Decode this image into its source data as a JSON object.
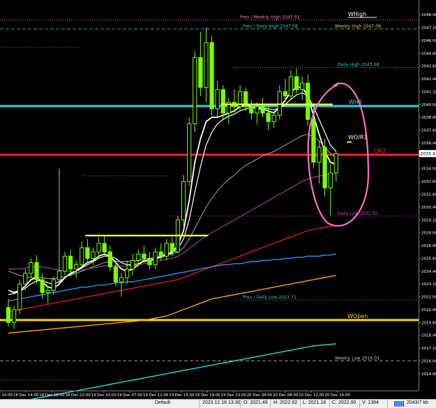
{
  "chart_data": {
    "type": "candlestick",
    "symbol_corner_label": "",
    "y_ticks": [
      "2048.40",
      "2047.20",
      "2046.00",
      "2044.80",
      "2043.60",
      "2042.40",
      "2041.20",
      "2040.00",
      "2038.80",
      "2037.60",
      "2036.40",
      "2035.20",
      "2034.00",
      "2032.80",
      "2031.60",
      "2030.40",
      "2029.20",
      "2028.00",
      "2026.80",
      "2025.60",
      "2024.40",
      "2023.20",
      "2022.00",
      "2020.80",
      "2019.60",
      "2018.40",
      "2017.20",
      "2016.00",
      "2014.80"
    ],
    "ylim": [
      2014.2,
      2049.0
    ],
    "price_marker": {
      "label": "2035.41",
      "value": 2035.41
    },
    "x_ticks": [
      "18 Dec 10:00",
      "18 Dec 14:00",
      "18 Dec 18:00",
      "18 Dec 22:00",
      "19 Dec 03:00",
      "19 Dec 07:00",
      "19 Dec 11:00",
      "19 Dec 15:00",
      "19 Dec 19:00",
      "19 Dec 23:00",
      "20 Dec 04:00",
      "20 Dec 08:00",
      "20 Dec 12:00",
      "20 Dec 16:00"
    ],
    "levels": [
      {
        "name": "Prev / Weekly High",
        "label": "Prev / Weekly High 2047.91",
        "value": 2047.91,
        "color": "#ff7fbf",
        "style": "dotted"
      },
      {
        "name": "Prev / Daily High",
        "label": "Prev / Daily High 2047.08",
        "value": 2047.08,
        "color": "#22d3cf",
        "style": "dashed"
      },
      {
        "name": "Weekly High",
        "label": "Weekly High 2047.08",
        "value": 2047.08,
        "color": "#d0d040",
        "style": "dashed"
      },
      {
        "name": "Daily High",
        "label": "Daily High 2043.48",
        "value": 2043.48,
        "color": "#22d3cf",
        "style": "dotted"
      },
      {
        "name": "WH3",
        "label": "WH3",
        "value": 2039.86,
        "color": "#22d8e8",
        "style": "solid"
      },
      {
        "name": "QR2",
        "label": "QR2",
        "value": 2035.3,
        "color": "#ff2020",
        "style": "solid"
      },
      {
        "name": "Daily Low",
        "label": "Daily Low 2031.02",
        "value": 2029.55,
        "color": "#e040e0",
        "style": "dotted"
      },
      {
        "name": "Prev / Daily Low",
        "label": "Prev / Daily Low 2021.71",
        "value": 2021.71,
        "color": "#22d3cf",
        "style": "dotted"
      },
      {
        "name": "WOpen",
        "label": "WOpen",
        "value": 2019.82,
        "color": "#ffd800",
        "style": "solid"
      },
      {
        "name": "Weekly Low",
        "label": "Weekly Low 2016.01",
        "value": 2016.01,
        "color": "#c0c0c0",
        "style": "dashed"
      }
    ],
    "chart_labels": [
      {
        "text": "WHigh",
        "value": 2048.4,
        "color": "#ffffff"
      },
      {
        "text": "WO/R1",
        "value": 2036.9,
        "color": "#ffffff"
      }
    ],
    "candles": [
      [
        2021.0,
        2021.8,
        2019.2,
        2019.6
      ],
      [
        2019.6,
        2021.2,
        2019.0,
        2020.8
      ],
      [
        2020.8,
        2023.6,
        2020.4,
        2023.2
      ],
      [
        2023.2,
        2024.6,
        2022.6,
        2024.2
      ],
      [
        2024.2,
        2025.6,
        2023.8,
        2025.2
      ],
      [
        2025.2,
        2025.9,
        2023.2,
        2023.6
      ],
      [
        2023.6,
        2024.2,
        2021.8,
        2022.4
      ],
      [
        2022.4,
        2023.0,
        2021.4,
        2022.6
      ],
      [
        2022.6,
        2023.9,
        2022.2,
        2023.6
      ],
      [
        2023.6,
        2034.0,
        2023.0,
        2024.4
      ],
      [
        2024.4,
        2026.2,
        2024.0,
        2025.8
      ],
      [
        2025.8,
        2026.4,
        2024.2,
        2024.6
      ],
      [
        2024.6,
        2025.4,
        2023.8,
        2025.0
      ],
      [
        2025.0,
        2027.2,
        2024.6,
        2026.6
      ],
      [
        2026.6,
        2027.4,
        2025.2,
        2025.6
      ],
      [
        2025.6,
        2026.6,
        2025.0,
        2026.2
      ],
      [
        2026.2,
        2027.6,
        2025.6,
        2027.0
      ],
      [
        2027.0,
        2027.8,
        2025.8,
        2026.2
      ],
      [
        2026.2,
        2026.8,
        2024.4,
        2024.8
      ],
      [
        2024.8,
        2025.4,
        2023.0,
        2023.4
      ],
      [
        2023.4,
        2024.2,
        2022.0,
        2023.8
      ],
      [
        2023.8,
        2025.4,
        2023.2,
        2024.6
      ],
      [
        2024.6,
        2026.0,
        2024.0,
        2025.4
      ],
      [
        2025.4,
        2026.4,
        2024.8,
        2026.0
      ],
      [
        2026.0,
        2026.8,
        2025.2,
        2025.6
      ],
      [
        2025.6,
        2026.2,
        2024.6,
        2025.0
      ],
      [
        2025.0,
        2026.6,
        2024.6,
        2026.2
      ],
      [
        2026.2,
        2027.0,
        2025.4,
        2025.8
      ],
      [
        2025.8,
        2027.4,
        2025.4,
        2027.0
      ],
      [
        2027.0,
        2027.6,
        2025.8,
        2026.2
      ],
      [
        2026.2,
        2029.6,
        2026.0,
        2029.2
      ],
      [
        2029.2,
        2033.4,
        2028.6,
        2032.8
      ],
      [
        2032.8,
        2038.8,
        2032.4,
        2038.2
      ],
      [
        2038.2,
        2045.0,
        2037.4,
        2044.4
      ],
      [
        2044.4,
        2046.8,
        2040.8,
        2041.6
      ],
      [
        2041.6,
        2047.2,
        2040.2,
        2045.8
      ],
      [
        2045.8,
        2046.4,
        2039.0,
        2039.6
      ],
      [
        2039.6,
        2042.2,
        2038.8,
        2041.4
      ],
      [
        2041.4,
        2041.8,
        2038.6,
        2039.2
      ],
      [
        2039.2,
        2040.6,
        2038.2,
        2040.2
      ],
      [
        2040.2,
        2041.4,
        2039.2,
        2039.8
      ],
      [
        2039.8,
        2041.8,
        2039.4,
        2041.2
      ],
      [
        2041.2,
        2041.6,
        2039.4,
        2039.8
      ],
      [
        2039.8,
        2040.4,
        2038.6,
        2039.2
      ],
      [
        2039.2,
        2040.2,
        2038.2,
        2039.8
      ],
      [
        2039.8,
        2040.6,
        2038.8,
        2039.2
      ],
      [
        2039.2,
        2039.8,
        2037.6,
        2038.4
      ],
      [
        2038.4,
        2039.4,
        2037.8,
        2039.0
      ],
      [
        2039.0,
        2041.8,
        2038.6,
        2041.2
      ],
      [
        2041.2,
        2042.4,
        2040.2,
        2040.8
      ],
      [
        2040.8,
        2043.2,
        2040.4,
        2042.6
      ],
      [
        2042.6,
        2043.4,
        2041.0,
        2041.4
      ],
      [
        2041.4,
        2042.6,
        2040.4,
        2042.0
      ],
      [
        2042.0,
        2042.8,
        2038.0,
        2038.6
      ],
      [
        2038.6,
        2039.6,
        2034.0,
        2034.6
      ],
      [
        2034.6,
        2036.6,
        2032.6,
        2036.0
      ],
      [
        2036.0,
        2036.8,
        2031.4,
        2032.2
      ],
      [
        2032.2,
        2034.4,
        2029.6,
        2033.6
      ],
      [
        2033.6,
        2035.6,
        2032.8,
        2035.4
      ]
    ],
    "moving_averages": [
      {
        "color": "#ffffff",
        "width": 1.8,
        "values": [
          2022.6,
          2022.4,
          2022.6,
          2023.0,
          2023.6,
          2023.8,
          2023.4,
          2022.9,
          2022.8,
          2023.2,
          2023.8,
          2024.2,
          2024.4,
          2024.8,
          2025.2,
          2025.4,
          2025.8,
          2026.0,
          2025.8,
          2025.2,
          2024.6,
          2024.4,
          2024.6,
          2025.0,
          2025.4,
          2025.4,
          2025.6,
          2025.8,
          2026.0,
          2026.2,
          2026.8,
          2028.2,
          2031.0,
          2034.6,
          2036.8,
          2038.4,
          2038.8,
          2038.8,
          2039.0,
          2039.2,
          2039.4,
          2039.8,
          2040.0,
          2039.8,
          2039.6,
          2039.6,
          2039.4,
          2039.2,
          2039.8,
          2040.4,
          2041.2,
          2041.6,
          2041.6,
          2040.8,
          2039.0,
          2037.2,
          2035.6,
          2034.6,
          2034.4
        ]
      },
      {
        "color": "#ffffff",
        "width": 1.2,
        "values": [
          2022.2,
          2022.3,
          2022.5,
          2022.8,
          2023.2,
          2023.5,
          2023.5,
          2023.3,
          2023.2,
          2023.4,
          2023.8,
          2024.1,
          2024.4,
          2024.7,
          2025.0,
          2025.3,
          2025.6,
          2025.8,
          2025.8,
          2025.6,
          2025.2,
          2025.0,
          2025.0,
          2025.1,
          2025.3,
          2025.4,
          2025.5,
          2025.7,
          2025.9,
          2026.1,
          2026.5,
          2027.4,
          2029.2,
          2031.8,
          2034.2,
          2036.2,
          2037.4,
          2038.2,
          2038.6,
          2038.9,
          2039.1,
          2039.4,
          2039.6,
          2039.7,
          2039.7,
          2039.7,
          2039.6,
          2039.5,
          2039.7,
          2040.0,
          2040.5,
          2040.9,
          2041.1,
          2040.8,
          2039.8,
          2038.6,
          2037.4,
          2036.2,
          2035.6
        ]
      },
      {
        "color": "#b8b8b8",
        "width": 0.9,
        "values": [
          2024.4,
          2024.2,
          2024.0,
          2023.9,
          2023.8,
          2023.8,
          2023.8,
          2023.7,
          2023.7,
          2023.8,
          2023.9,
          2024.0,
          2024.2,
          2024.4,
          2024.6,
          2024.8,
          2025.0,
          2025.2,
          2025.3,
          2025.3,
          2025.3,
          2025.3,
          2025.3,
          2025.4,
          2025.5,
          2025.6,
          2025.7,
          2025.8,
          2025.9,
          2026.0,
          2026.2,
          2026.6,
          2027.4,
          2028.4,
          2029.4,
          2030.4,
          2031.2,
          2031.9,
          2032.5,
          2033.0,
          2033.4,
          2033.9,
          2034.3,
          2034.6,
          2034.9,
          2035.2,
          2035.4,
          2035.6,
          2035.9,
          2036.2,
          2036.5,
          2036.8,
          2037.1,
          2037.2,
          2037.0,
          2036.6,
          2036.0,
          2035.4,
          2035.0
        ]
      },
      {
        "color": "#c040c0",
        "width": 1.0,
        "values": [
          2024.6,
          2024.6,
          2024.6,
          2024.7,
          2024.8,
          2024.8,
          2024.8,
          2024.7,
          2024.6,
          2024.5,
          2024.4,
          2024.4,
          2024.4,
          2024.5,
          2024.6,
          2024.7,
          2024.8,
          2024.9,
          2024.9,
          2024.9,
          2024.9,
          2024.9,
          2024.9,
          2025.0,
          2025.1,
          2025.2,
          2025.3,
          2025.4,
          2025.5,
          2025.6,
          2025.8,
          2026.1,
          2026.5,
          2026.9,
          2027.3,
          2027.7,
          2028.0,
          2028.3,
          2028.6,
          2028.9,
          2029.2,
          2029.5,
          2029.8,
          2030.1,
          2030.4,
          2030.7,
          2031.0,
          2031.3,
          2031.6,
          2031.9,
          2032.2,
          2032.5,
          2032.8,
          2033.0,
          2033.2,
          2033.3,
          2033.4,
          2033.5,
          2033.5
        ]
      },
      {
        "color": "#e01818",
        "width": 1.4,
        "values": [
          2020.6,
          2020.7,
          2020.8,
          2020.9,
          2021.0,
          2021.1,
          2021.2,
          2021.3,
          2021.4,
          2021.5,
          2021.6,
          2021.7,
          2021.8,
          2021.9,
          2022.0,
          2022.1,
          2022.2,
          2022.3,
          2022.4,
          2022.5,
          2022.6,
          2022.7,
          2022.8,
          2022.9,
          2023.0,
          2023.1,
          2023.2,
          2023.3,
          2023.4,
          2023.5,
          2023.6,
          2023.8,
          2024.0,
          2024.2,
          2024.4,
          2024.6,
          2024.8,
          2025.0,
          2025.2,
          2025.4,
          2025.6,
          2025.8,
          2026.0,
          2026.2,
          2026.4,
          2026.6,
          2026.8,
          2027.0,
          2027.2,
          2027.4,
          2027.6,
          2027.8,
          2028.0,
          2028.2,
          2028.3,
          2028.4,
          2028.5,
          2028.6,
          2028.7
        ]
      },
      {
        "color": "#2a8fff",
        "width": 1.4,
        "values": [
          2021.6,
          2021.7,
          2021.8,
          2021.9,
          2022.0,
          2022.1,
          2022.2,
          2022.3,
          2022.4,
          2022.5,
          2022.6,
          2022.7,
          2022.8,
          2022.9,
          2022.9,
          2023.0,
          2023.1,
          2023.1,
          2023.2,
          2023.3,
          2023.3,
          2023.4,
          2023.4,
          2023.5,
          2023.6,
          2023.7,
          2023.8,
          2023.9,
          2024.0,
          2024.1,
          2024.2,
          2024.3,
          2024.4,
          2024.5,
          2024.6,
          2024.7,
          2024.8,
          2024.9,
          2025.0,
          2025.0,
          2025.1,
          2025.1,
          2025.2,
          2025.3,
          2025.3,
          2025.4,
          2025.4,
          2025.5,
          2025.5,
          2025.6,
          2025.6,
          2025.7,
          2025.7,
          2025.8,
          2025.8,
          2025.8,
          2025.9,
          2025.9,
          2026.0
        ]
      },
      {
        "color": "#ffa500",
        "width": 1.4,
        "values": [
          2018.6,
          2018.65,
          2018.7,
          2018.75,
          2018.8,
          2018.85,
          2018.9,
          2018.95,
          2019.0,
          2019.05,
          2019.1,
          2019.15,
          2019.2,
          2019.25,
          2019.3,
          2019.35,
          2019.4,
          2019.45,
          2019.5,
          2019.55,
          2019.6,
          2019.65,
          2019.7,
          2019.75,
          2019.8,
          2019.9,
          2020.0,
          2020.1,
          2020.2,
          2020.4,
          2020.6,
          2020.8,
          2021.0,
          2021.2,
          2021.4,
          2021.6,
          2021.8,
          2021.9,
          2022.0,
          2022.1,
          2022.2,
          2022.3,
          2022.4,
          2022.5,
          2022.6,
          2022.7,
          2022.8,
          2022.9,
          2023.0,
          2023.1,
          2023.2,
          2023.3,
          2023.4,
          2023.5,
          2023.6,
          2023.7,
          2023.8,
          2023.9,
          2024.0
        ]
      },
      {
        "color": "#22e0e0",
        "width": 1.4,
        "values": [
          2012.0,
          2012.1,
          2012.2,
          2012.3,
          2012.4,
          2012.5,
          2012.6,
          2012.7,
          2012.8,
          2012.9,
          2013.0,
          2013.1,
          2013.2,
          2013.3,
          2013.4,
          2013.5,
          2013.6,
          2013.7,
          2013.8,
          2013.9,
          2014.0,
          2014.1,
          2014.2,
          2014.3,
          2014.4,
          2014.5,
          2014.6,
          2014.7,
          2014.8,
          2014.9,
          2015.0,
          2015.1,
          2015.2,
          2015.3,
          2015.4,
          2015.5,
          2015.6,
          2015.7,
          2015.8,
          2015.9,
          2016.0,
          2016.1,
          2016.2,
          2016.3,
          2016.4,
          2016.5,
          2016.6,
          2016.7,
          2016.8,
          2016.9,
          2017.0,
          2017.1,
          2017.2,
          2017.3,
          2017.4,
          2017.45,
          2017.5,
          2017.55,
          2017.6
        ]
      }
    ],
    "yellow_segments": [
      {
        "value": 2027.73,
        "from": 14,
        "to": 35
      },
      {
        "value": 2040.02,
        "from": 38,
        "to": 57
      }
    ]
  },
  "status_bar": {
    "profile": "Default",
    "datetime": "2023.12.18 13:30",
    "open": "O: 2021.49",
    "high": "H: 2022.62",
    "low": "L: 2021.16",
    "close": "C: 2022.00",
    "volume": "V: 1384",
    "traffic": "2043/7 kb"
  }
}
